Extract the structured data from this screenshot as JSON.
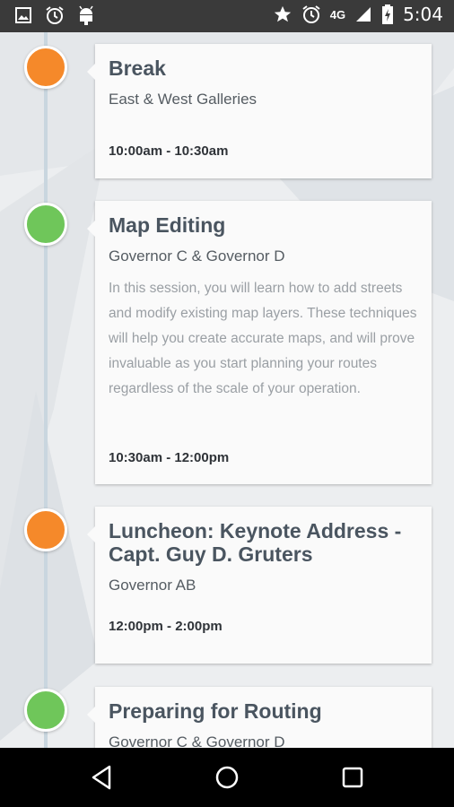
{
  "status_bar": {
    "left_icons": [
      "image-icon",
      "alarm-icon",
      "android-icon"
    ],
    "right_icons": [
      "star-icon",
      "alarm-icon",
      "signal-icon",
      "battery-icon"
    ],
    "network": "4G",
    "time": "5:04"
  },
  "sessions": [
    {
      "title": "Break",
      "room": "East & West Galleries",
      "description": "",
      "time": "10:00am - 10:30am",
      "color": "#f5892a"
    },
    {
      "title": "Map Editing",
      "room": "Governor C & Governor D",
      "description": "In this session, you will learn how to add streets and modify existing map layers. These techniques will help you create accurate maps, and will prove invaluable as you start planning your routes regardless of the scale of your operation.",
      "time": "10:30am - 12:00pm",
      "color": "#6fc65a"
    },
    {
      "title": "Luncheon: Keynote Address - Capt. Guy D. Gruters",
      "room": "Governor AB",
      "description": "",
      "time": "12:00pm - 2:00pm",
      "color": "#f5892a"
    },
    {
      "title": "Preparing for Routing",
      "room": "Governor C & Governor D",
      "description": "",
      "time": "",
      "color": "#6fc65a"
    }
  ],
  "nav_bar": {
    "buttons": [
      "back-icon",
      "home-icon",
      "recents-icon"
    ]
  }
}
